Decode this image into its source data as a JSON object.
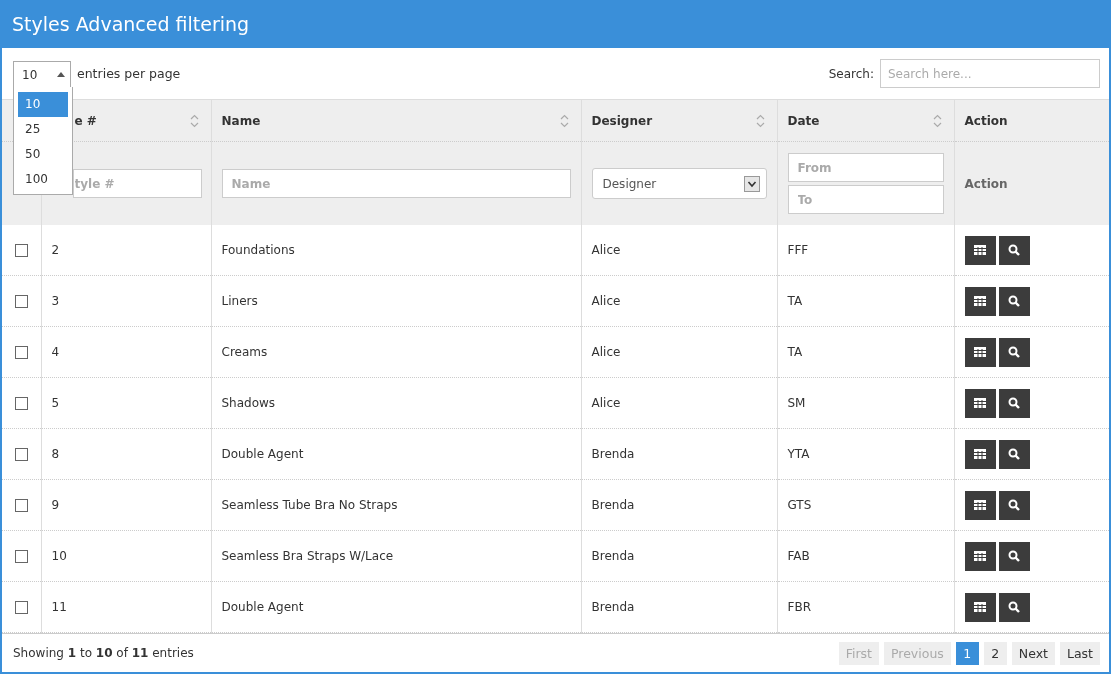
{
  "window": {
    "title": "Styles Advanced filtering"
  },
  "page_size": {
    "value": "10",
    "expanded": true,
    "label": "entries per page",
    "options": [
      {
        "label": "10",
        "selected": true
      },
      {
        "label": "25",
        "selected": false
      },
      {
        "label": "50",
        "selected": false
      },
      {
        "label": "100",
        "selected": false
      }
    ]
  },
  "search": {
    "label": "Search:",
    "placeholder": "Search here..."
  },
  "table": {
    "columns": [
      {
        "label": "e #",
        "sortable": true
      },
      {
        "label": "Name",
        "sortable": true
      },
      {
        "label": "Designer",
        "sortable": true
      },
      {
        "label": "Date",
        "sortable": true
      },
      {
        "label": "Action",
        "sortable": false
      }
    ],
    "filters": {
      "style": {
        "placeholder": "tyle #"
      },
      "name": {
        "placeholder": "Name"
      },
      "designer": "Designer",
      "date_from": {
        "placeholder": "From"
      },
      "date_to": {
        "placeholder": "To"
      },
      "action": "Action"
    },
    "rows": [
      {
        "checked": false,
        "style": "2",
        "name": "Foundations",
        "designer": "Alice",
        "date": "FFF"
      },
      {
        "checked": false,
        "style": "3",
        "name": "Liners",
        "designer": "Alice",
        "date": "TA"
      },
      {
        "checked": false,
        "style": "4",
        "name": "Creams",
        "designer": "Alice",
        "date": "TA"
      },
      {
        "checked": false,
        "style": "5",
        "name": "Shadows",
        "designer": "Alice",
        "date": "SM"
      },
      {
        "checked": false,
        "style": "8",
        "name": "Double Agent",
        "designer": "Brenda",
        "date": "YTA"
      },
      {
        "checked": false,
        "style": "9",
        "name": "Seamless Tube Bra No Straps",
        "designer": "Brenda",
        "date": "GTS"
      },
      {
        "checked": false,
        "style": "10",
        "name": "Seamless Bra Straps W/Lace",
        "designer": "Brenda",
        "date": "FAB"
      },
      {
        "checked": false,
        "style": "11",
        "name": "Double Agent",
        "designer": "Brenda",
        "date": "FBR"
      }
    ]
  },
  "footer": {
    "summary": "Showing **1** to **10** of **11** entries"
  },
  "pagination": [
    {
      "label": "First",
      "kind": "nav",
      "disabled": true,
      "selected": false
    },
    {
      "label": "Previous",
      "kind": "nav",
      "disabled": true,
      "selected": false
    },
    {
      "label": "1",
      "kind": "page",
      "disabled": false,
      "selected": true
    },
    {
      "label": "2",
      "kind": "page",
      "disabled": false,
      "selected": false
    },
    {
      "label": "Next",
      "kind": "nav",
      "disabled": false,
      "selected": false
    },
    {
      "label": "Last",
      "kind": "nav",
      "disabled": false,
      "selected": false
    }
  ]
}
